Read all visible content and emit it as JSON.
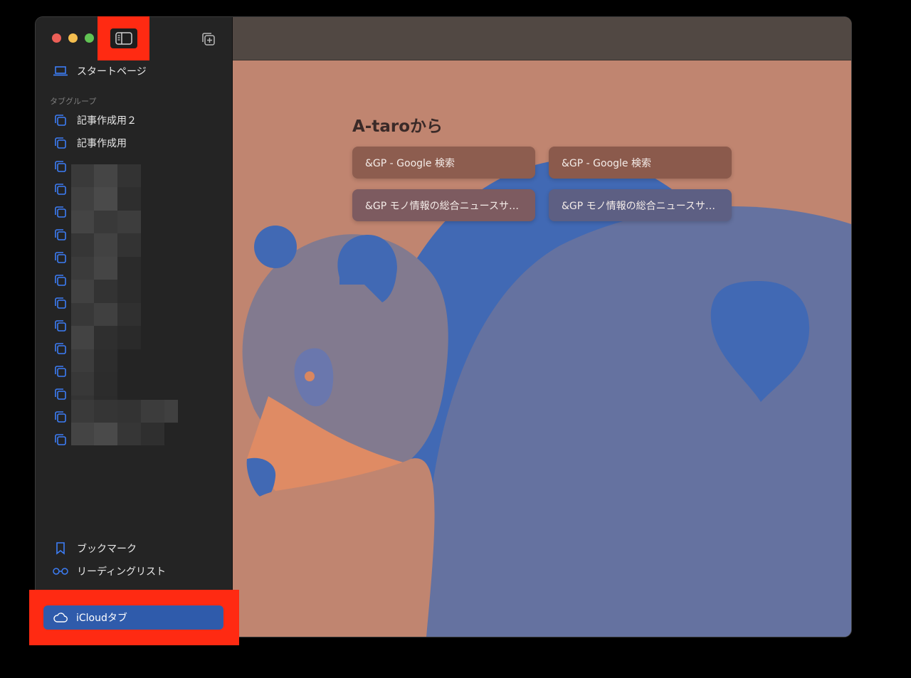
{
  "sidebar": {
    "start_page_label": "スタートページ",
    "section_label": "タブグループ",
    "tab_groups": [
      {
        "label": "記事作成用２"
      },
      {
        "label": "記事作成用"
      }
    ],
    "bookmarks_label": "ブックマーク",
    "reading_list_label": "リーディングリスト",
    "icloud_tabs_label": "iCloudタブ"
  },
  "content": {
    "heading": "A-taroから",
    "cards": [
      {
        "label": "&GP - Google 検索"
      },
      {
        "label": "&GP - Google 検索"
      },
      {
        "label": "&GP モノ情報の総合ニュースサ…"
      },
      {
        "label": "&GP モノ情報の総合ニュースサ…"
      }
    ]
  },
  "colors": {
    "accent": "#2f5bab",
    "highlight": "#ff2a12",
    "background_top": "#514843",
    "background_main": "#c08570"
  },
  "icons": {
    "sidebar_toggle": "sidebar-toggle-icon",
    "new_tab": "new-tab-icon",
    "start_page": "laptop-icon",
    "tab_group": "tab-group-icon",
    "bookmark": "bookmark-icon",
    "reading_list": "glasses-icon",
    "icloud": "cloud-icon"
  }
}
